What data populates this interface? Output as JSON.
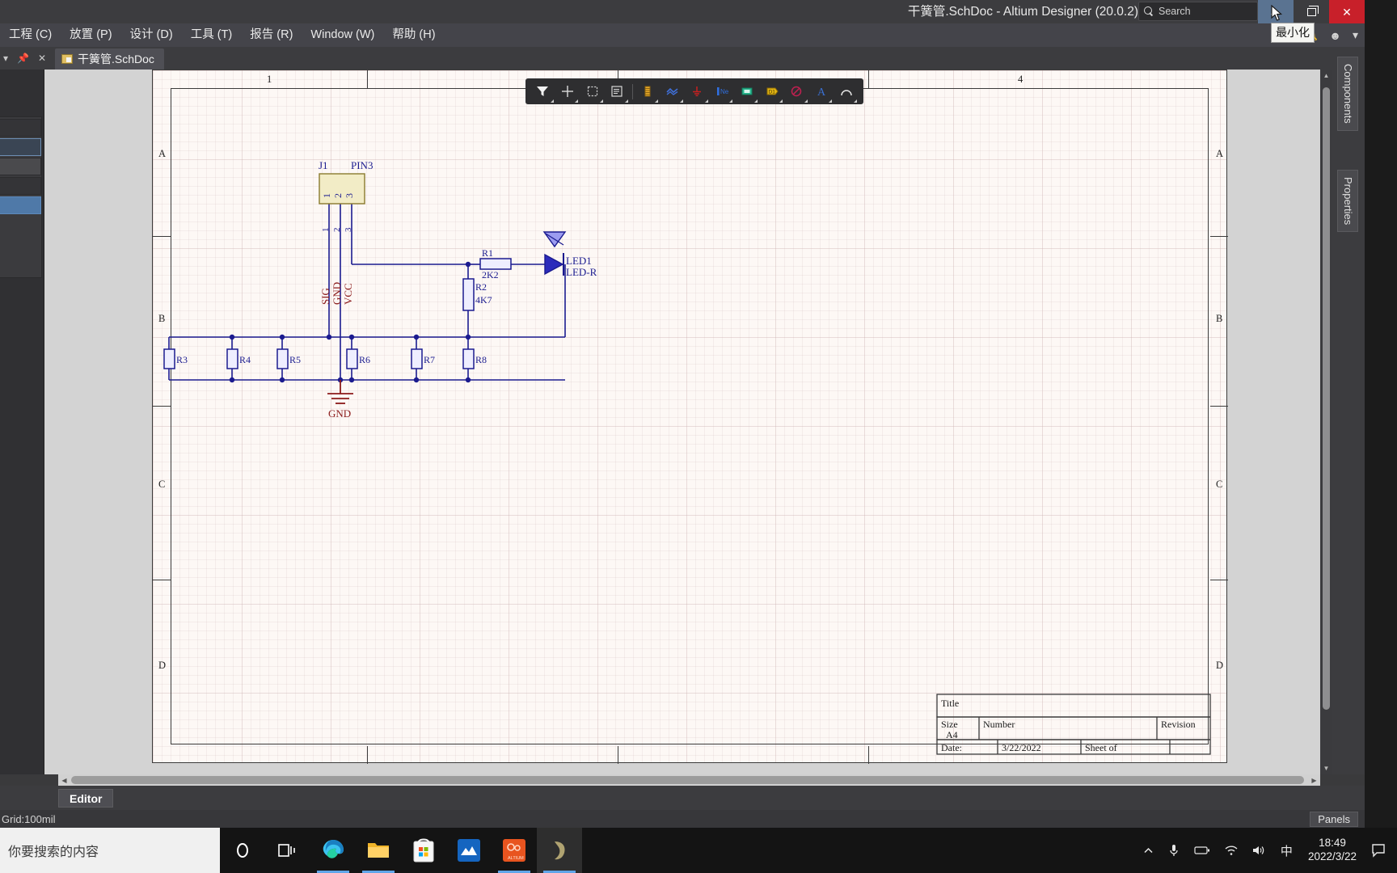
{
  "window": {
    "title": "干簧管.SchDoc - Altium Designer (20.0.2)",
    "search_placeholder": "Search",
    "minimize_tooltip": "最小化",
    "minimize_label": "Minimize",
    "maximize_label": "Restore",
    "close_label": "Close"
  },
  "menubar": {
    "items": [
      {
        "label": "工程 (C)"
      },
      {
        "label": "放置 (P)"
      },
      {
        "label": "设计 (D)"
      },
      {
        "label": "工具 (T)"
      },
      {
        "label": "报告 (R)"
      },
      {
        "label": "Window (W)"
      },
      {
        "label": "帮助 (H)"
      }
    ],
    "account_icons": [
      "refresh-icon",
      "bell-icon",
      "account-icon",
      "chevron-down-icon"
    ]
  },
  "tabstrip": {
    "panel_controls": [
      "chevron-down-icon",
      "pin-icon",
      "close-icon"
    ],
    "document_tab": "干簧管.SchDoc"
  },
  "toolbar": {
    "buttons": [
      {
        "name": "filter-icon",
        "tip": "Filter"
      },
      {
        "name": "crosshair-place-icon",
        "tip": "Place"
      },
      {
        "name": "rectangle-icon",
        "tip": "Rectangle"
      },
      {
        "name": "sheet-symbol-icon",
        "tip": "Sheet Symbol"
      },
      {
        "name": "component-icon",
        "tip": "Place Part"
      },
      {
        "name": "wire-icon",
        "tip": "Place Wire"
      },
      {
        "name": "gnd-power-port-icon",
        "tip": "GND Power Port"
      },
      {
        "name": "net-label-icon",
        "tip": "Net Label"
      },
      {
        "name": "port-icon",
        "tip": "Place Port"
      },
      {
        "name": "designator-icon",
        "tip": "Designator"
      },
      {
        "name": "no-erc-icon",
        "tip": "No ERC"
      },
      {
        "name": "text-string-icon",
        "tip": "Text String"
      },
      {
        "name": "arc-icon",
        "tip": "Place Arc"
      }
    ]
  },
  "sheet": {
    "zone_columns": [
      "1",
      "4"
    ],
    "zone_rows": [
      "A",
      "B",
      "C",
      "D"
    ],
    "title_block": {
      "title_label": "Title",
      "title_value": "",
      "size_label": "Size",
      "size_value": "A4",
      "number_label": "Number",
      "number_value": "",
      "revision_label": "Revision",
      "revision_value": "",
      "date_label": "Date:",
      "date_value": "3/22/2022",
      "sheet_label": "Sheet  of",
      "file_label": ""
    }
  },
  "schematic": {
    "connector": {
      "designator": "J1",
      "comment": "PIN3",
      "pin_numbers": [
        "1",
        "2",
        "3"
      ],
      "pin_names": [
        "SIG",
        "GND",
        "VCC"
      ]
    },
    "components": [
      {
        "designator": "R1",
        "value": "2K2"
      },
      {
        "designator": "R2",
        "value": "4K7"
      },
      {
        "designator": "R3",
        "value": ""
      },
      {
        "designator": "R4",
        "value": ""
      },
      {
        "designator": "R5",
        "value": ""
      },
      {
        "designator": "R6",
        "value": ""
      },
      {
        "designator": "R7",
        "value": ""
      },
      {
        "designator": "R8",
        "value": ""
      },
      {
        "designator": "LED1",
        "value": "LED-R"
      }
    ],
    "power_ports": [
      {
        "label": "GND"
      }
    ],
    "colors": {
      "wire": "#1b1b8f",
      "component_outline": "#1b1b8f",
      "connector_fill": "#f2ecc6",
      "power_port": "#8b1a1a",
      "pin_name": "#8b1a1a",
      "sheet_bg": "#fdf8f5"
    }
  },
  "right_panel_tabs": [
    {
      "label": "Components"
    },
    {
      "label": "Properties"
    }
  ],
  "bottom": {
    "editor_tab": "Editor",
    "status_grid": "Grid:100mil",
    "panels_button": "Panels"
  },
  "taskbar": {
    "search_text": "你要搜索的内容",
    "items": [
      {
        "name": "cortana-icon",
        "active": false
      },
      {
        "name": "task-view-icon",
        "active": false
      },
      {
        "name": "edge-icon",
        "active": true
      },
      {
        "name": "file-explorer-icon",
        "active": true
      },
      {
        "name": "microsoft-store-icon",
        "active": false
      },
      {
        "name": "app-blue-icon",
        "active": false
      },
      {
        "name": "altium-designer-icon",
        "active": true
      },
      {
        "name": "altium-running-icon",
        "active": true
      }
    ],
    "tray": {
      "icons": [
        "chevron-up-icon",
        "microphone-icon",
        "battery-icon",
        "wifi-icon",
        "volume-icon"
      ],
      "ime": "中",
      "time": "18:49",
      "date": "2022/3/22",
      "notification": "action-center-icon"
    }
  }
}
